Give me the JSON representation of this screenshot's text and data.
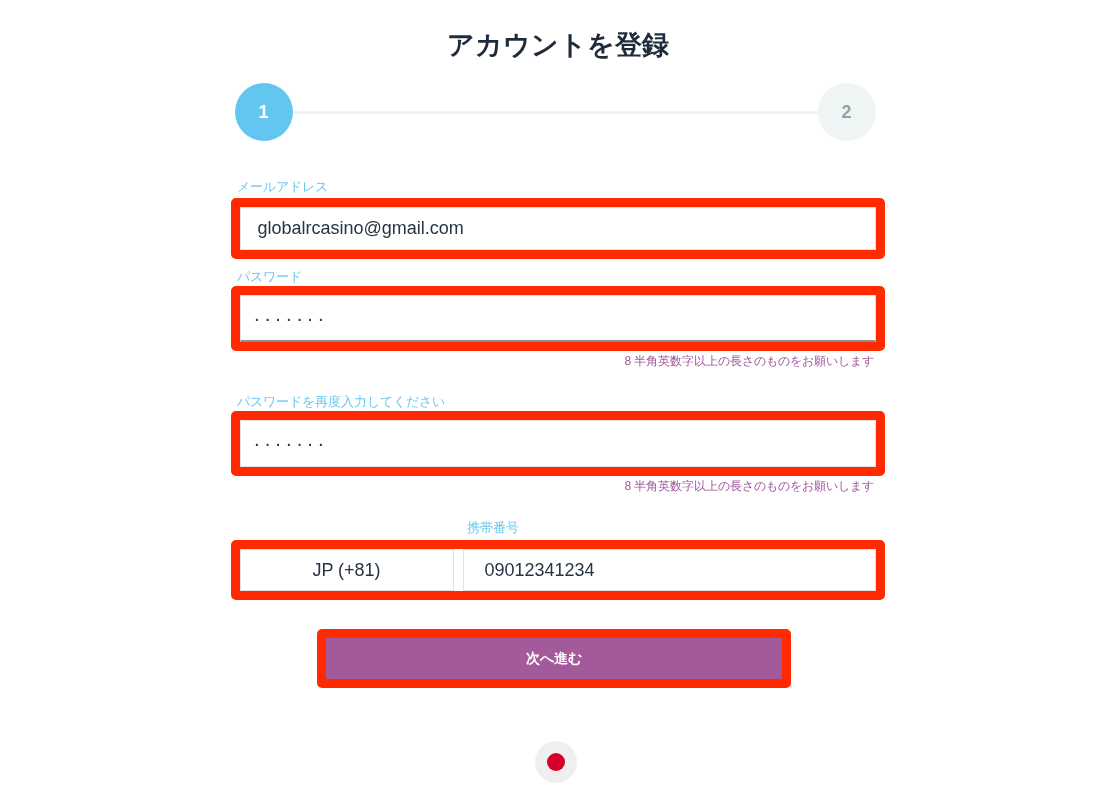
{
  "title": "アカウントを登録",
  "steps": [
    {
      "label": "1",
      "selected": true
    },
    {
      "label": "2",
      "selected": false
    }
  ],
  "fields": [
    {
      "kind": "email",
      "label": "メールアドレス",
      "value": "globalrcasino@gmail.com",
      "highlighted": true,
      "focused": false
    },
    {
      "kind": "password",
      "label": "パスワード",
      "value": "·······",
      "hint": "8 半角英数字以上の長さのものをお願いします",
      "highlighted": true,
      "focused": true
    },
    {
      "kind": "password",
      "label": "パスワードを再度入力してください",
      "value": "·······",
      "hint": "8 半角英数字以上の長さのものをお願いします",
      "highlighted": true,
      "focused": false
    },
    {
      "kind": "phone",
      "label": "携帯番号",
      "country_code": "JP (+81)",
      "value": "09012341234",
      "highlighted": true,
      "focused": false
    }
  ],
  "next_button": {
    "label": "次へ進む",
    "highlighted": true
  }
}
